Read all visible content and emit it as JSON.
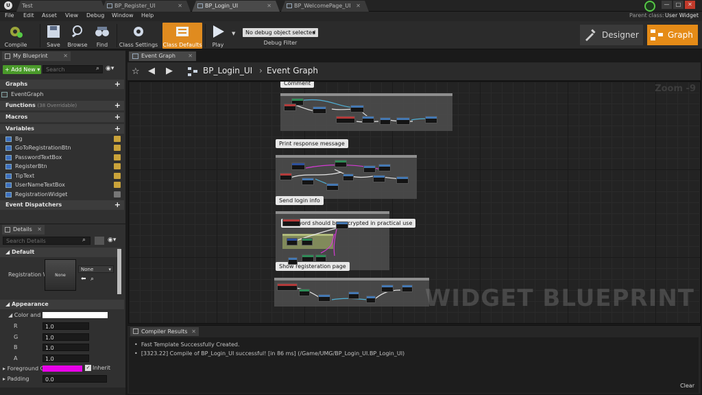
{
  "window": {
    "tabs": [
      {
        "label": "Test"
      },
      {
        "label": "BP_Register_UI"
      },
      {
        "label": "BP_Login_UI"
      },
      {
        "label": "BP_WelcomePage_UI"
      }
    ],
    "parent_class_label": "Parent class:",
    "parent_class_value": "User Widget"
  },
  "menu": [
    "File",
    "Edit",
    "Asset",
    "View",
    "Debug",
    "Window",
    "Help"
  ],
  "toolbar": {
    "compile": "Compile",
    "save": "Save",
    "browse": "Browse",
    "find": "Find",
    "class_settings": "Class Settings",
    "class_defaults": "Class Defaults",
    "play": "Play",
    "debug_object": "No debug object selected",
    "debug_filter": "Debug Filter",
    "designer": "Designer",
    "graph": "Graph"
  },
  "my_blueprint": {
    "tab_label": "My Blueprint",
    "add_new": "+ Add New",
    "search_placeholder": "Search",
    "graphs_header": "Graphs",
    "event_graph_item": "EventGraph",
    "functions_header": "Functions",
    "functions_sub": "(38 Overridable)",
    "macros_header": "Macros",
    "variables_header": "Variables",
    "variables": [
      {
        "name": "Bg",
        "visible": true
      },
      {
        "name": "GoToRegistrationBtn",
        "visible": true
      },
      {
        "name": "PasswordTextBox",
        "visible": true
      },
      {
        "name": "RegisterBtn",
        "visible": true
      },
      {
        "name": "TipText",
        "visible": true
      },
      {
        "name": "UserNameTextBox",
        "visible": true
      },
      {
        "name": "RegistrationWidget",
        "visible": false
      }
    ],
    "dispatchers_header": "Event Dispatchers"
  },
  "details": {
    "tab_label": "Details",
    "search_placeholder": "Search Details",
    "default_header": "Default",
    "registration_label": "Registration W",
    "thumb_label": "None",
    "asset_dropdown": "None",
    "appearance_header": "Appearance",
    "color_label": "Color and Op",
    "rows": [
      {
        "label": "R",
        "value": "1.0"
      },
      {
        "label": "G",
        "value": "1.0"
      },
      {
        "label": "B",
        "value": "1.0"
      },
      {
        "label": "A",
        "value": "1.0"
      }
    ],
    "foreground_label": "Foreground C",
    "foreground_color": "#e800e8",
    "inherit_label": "Inherit",
    "padding_label": "Padding",
    "padding_value": "0.0"
  },
  "graph": {
    "tab_label": "Event Graph",
    "blueprint_name": "BP_Login_UI",
    "separator": "›",
    "graph_name": "Event Graph",
    "zoom": "Zoom -9",
    "watermark": "WIDGET BLUEPRINT",
    "comments": [
      "Comment",
      "Print response message",
      "Send login info",
      "password should be encrypted in practical use",
      "Show registeration page"
    ]
  },
  "compiler": {
    "tab_label": "Compiler Results",
    "messages": [
      "Fast Template Successfully Created.",
      "[3323.22] Compile of BP_Login_UI successful! [in 86 ms] (/Game/UMG/BP_Login_UI.BP_Login_UI)"
    ],
    "clear": "Clear"
  },
  "colors": {
    "accent": "#e08b1f",
    "status_ok": "#56c946"
  }
}
